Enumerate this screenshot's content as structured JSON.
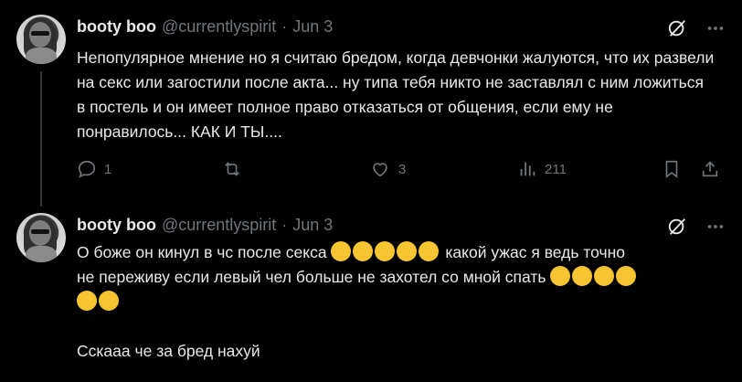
{
  "posts": [
    {
      "author_name": "booty boo",
      "handle": "@currentlyspirit",
      "separator": "·",
      "date": "Jun 3",
      "text": "Непопулярное мнение но я считаю бредом, когда девчонки жалуются, что их развели на секс или загостили после акта... ну типа тебя никто не заставлял с ним ложиться в постель и он имеет полное право отказаться от общения, если ему не понравилось... КАК И ТЫ....",
      "replies": "1",
      "reposts": "",
      "likes": "3",
      "views": "211"
    },
    {
      "author_name": "booty boo",
      "handle": "@currentlyspirit",
      "separator": "·",
      "date": "Jun 3",
      "text_line1": "О боже он кинул в чс после секса",
      "text_line1_tail": "какой ужас я ведь точно",
      "text_line2": "не переживу если левый чел больше не захотел со мной спать",
      "text_line4": "Сскааа че за бред нахуй",
      "emoji_icons": [
        "loudly-crying-face",
        "loudly-crying-face",
        "tired-face",
        "tired-face",
        "tired-face",
        "frowning-face",
        "frowning-face",
        "disappointed-face",
        "disappointed-face",
        "disappointed-face",
        "disappointed-face"
      ]
    }
  ],
  "colors": {
    "background": "#000000",
    "text": "#e7e9ea",
    "muted": "#71767b",
    "thread_line": "#333639",
    "emoji": "#f7c531"
  }
}
